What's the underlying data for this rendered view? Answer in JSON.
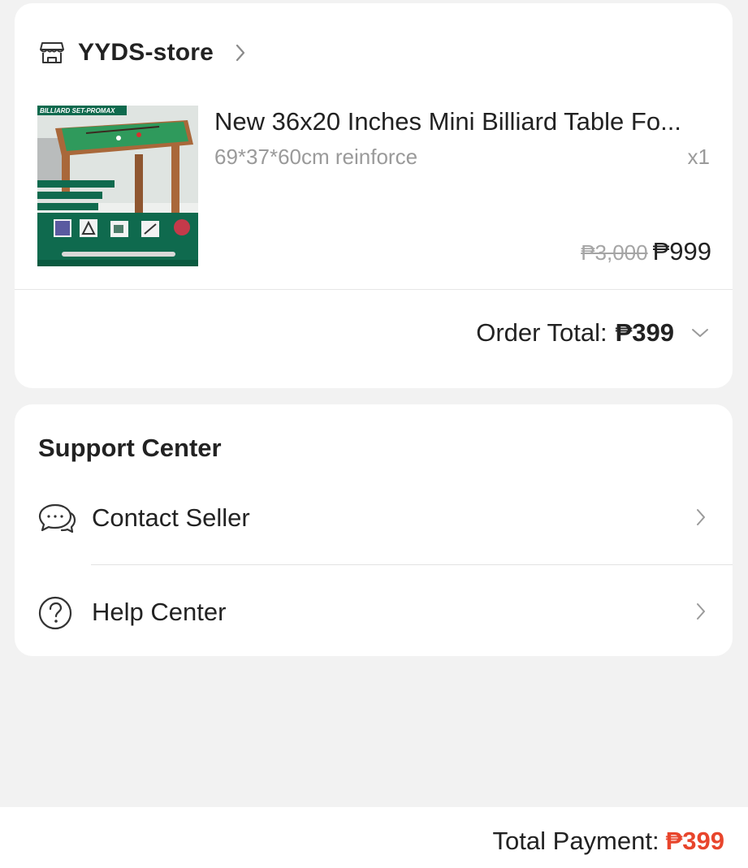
{
  "store": {
    "name": "YYDS-store"
  },
  "product": {
    "title": "New 36x20 Inches Mini Billiard Table Fo...",
    "variant": "69*37*60cm reinforce",
    "quantity": "x1",
    "original_price": "₱3,000",
    "price": "₱999",
    "image_banner": "BILLIARD SET-PROMAX"
  },
  "order_total": {
    "label": "Order Total:",
    "value": "₱399"
  },
  "support": {
    "title": "Support Center",
    "items": [
      {
        "label": "Contact Seller",
        "icon": "chat-bubbles-icon"
      },
      {
        "label": "Help Center",
        "icon": "question-circle-icon"
      }
    ]
  },
  "footer": {
    "total_label": "Total Payment:",
    "total_value": "₱399"
  },
  "colors": {
    "background": "#f2f2f2",
    "card": "#ffffff",
    "accent": "#e8452c",
    "text": "#222222",
    "muted": "#9a9a9a"
  }
}
